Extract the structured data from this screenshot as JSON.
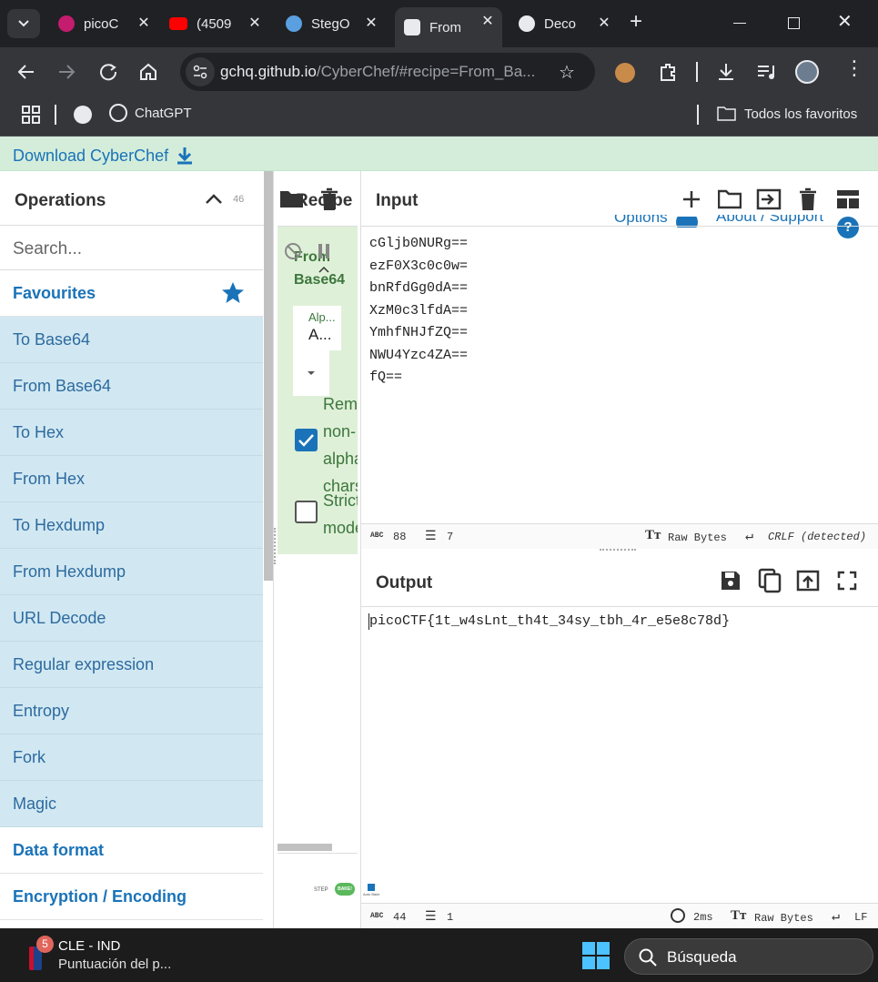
{
  "browser": {
    "tabs": [
      {
        "title": "picoC",
        "icon": "picoctf-icon"
      },
      {
        "title": "(4509",
        "icon": "youtube-icon"
      },
      {
        "title": "StegO",
        "icon": "stego-icon"
      },
      {
        "title": "From",
        "icon": "cyberchef-icon"
      },
      {
        "title": "Deco",
        "icon": "openai-icon"
      }
    ],
    "url_domain": "gchq.github.io",
    "url_path": "/CyberChef/#recipe=From_Ba...",
    "bookmarks": [
      {
        "label": "ChatGPT"
      }
    ],
    "all_bookmarks": "Todos los favoritos"
  },
  "banner": {
    "download_label": "Download CyberChef"
  },
  "operations": {
    "title": "Operations",
    "search_placeholder": "Search...",
    "favourites_label": "Favourites",
    "items": [
      "To Base64",
      "From Base64",
      "To Hex",
      "From Hex",
      "To Hexdump",
      "From Hexdump",
      "URL Decode",
      "Regular expression",
      "Entropy",
      "Fork",
      "Magic"
    ],
    "categories": [
      "Data format",
      "Encryption / Encoding"
    ],
    "cut_number": "46"
  },
  "recipe": {
    "title": "Recipe",
    "op_name": "From Base64",
    "alphabet_label": "Alp...",
    "alphabet_value": "A...",
    "remove_nonalpha_label": "Remove non-alphabet chars",
    "strict_mode_label": "Strict mode",
    "remove_nonalpha_checked": true,
    "strict_mode_checked": false,
    "step_label": "STEP",
    "bake_label": "BAKE!",
    "autobake_label": "Auto Bake"
  },
  "input": {
    "title": "Input",
    "options_label": "Options",
    "about_label": "About / Support",
    "lines": [
      "cGljb0NURg==",
      "ezF0X3c0c0w=",
      "bnRfdGg0dA==",
      "XzM0c3lfdA==",
      "YmhfNHJfZQ==",
      "NWU4Yzc4ZA==",
      "fQ=="
    ],
    "char_count": "88",
    "line_count": "7",
    "encoding": "Raw Bytes",
    "eol": "CRLF (detected)"
  },
  "output": {
    "title": "Output",
    "text": "picoCTF{1t_w4sLnt_th4t_34sy_tbh_4r_e5e8c78d}",
    "char_count": "44",
    "line_count": "1",
    "time": "2ms",
    "encoding": "Raw Bytes",
    "eol": "LF"
  },
  "taskbar": {
    "news_title": "CLE - IND",
    "news_subtitle": "Puntuación del p...",
    "badge": "5",
    "search_label": "Búsqueda"
  }
}
